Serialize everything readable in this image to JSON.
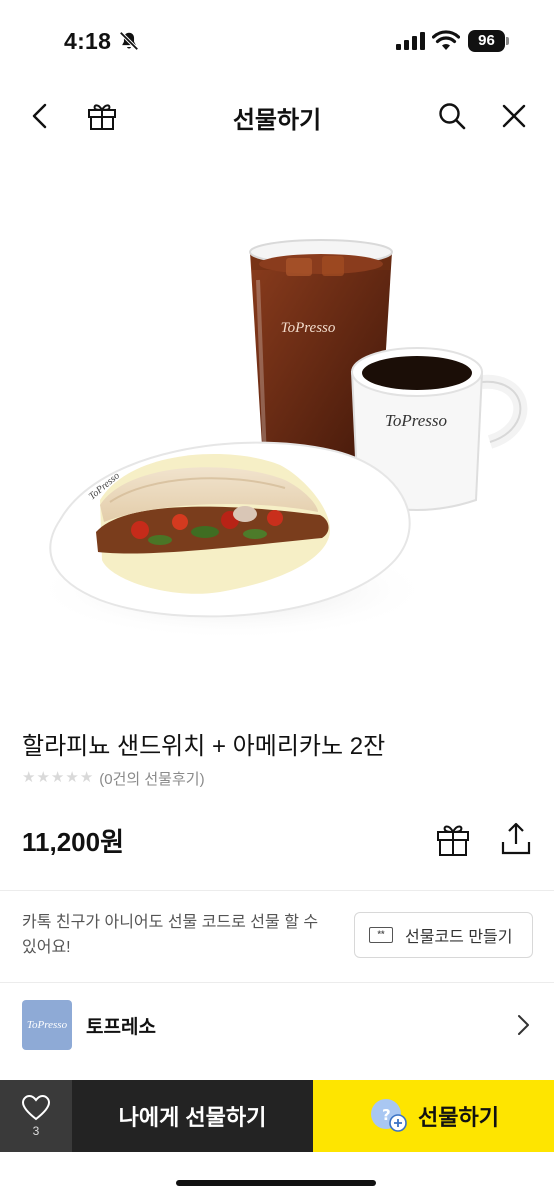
{
  "status_bar": {
    "time": "4:18",
    "battery": "96",
    "icons": [
      "bell-off-icon",
      "signal-icon",
      "wifi-icon",
      "battery-icon"
    ]
  },
  "nav": {
    "title": "선물하기",
    "icons": [
      "back-icon",
      "gift-icon",
      "search-icon",
      "close-icon"
    ]
  },
  "hero": {
    "brand_marks": [
      "ToPresso",
      "ToPresso",
      "ToPresso"
    ]
  },
  "product": {
    "name": "할라피뇨 샌드위치 + 아메리카노 2잔",
    "rating": 0,
    "review_text": "(0건의 선물후기)",
    "price": "11,200원"
  },
  "gift_code": {
    "description": "카톡 친구가 아니어도 선물 코드로 선물 할 수 있어요!",
    "button_label": "선물코드 만들기",
    "icon_text": "**"
  },
  "brand": {
    "logo_text": "ToPresso",
    "name": "토프레소"
  },
  "bottom_bar": {
    "wish_count": "3",
    "self_gift_label": "나에게 선물하기",
    "gift_label": "선물하기"
  },
  "colors": {
    "accent_yellow": "#fee500",
    "dark": "#232323",
    "brand_blue": "#8eaad6"
  }
}
